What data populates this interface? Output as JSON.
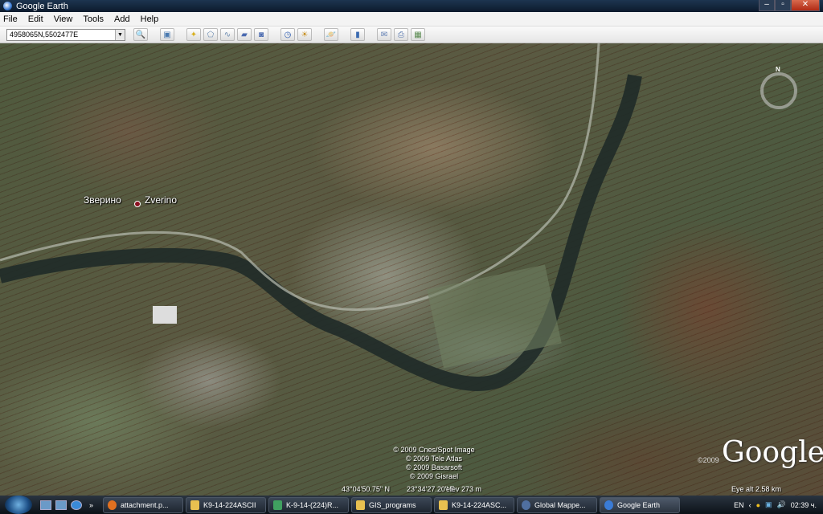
{
  "window": {
    "title": "Google Earth"
  },
  "menu": [
    "File",
    "Edit",
    "View",
    "Tools",
    "Add",
    "Help"
  ],
  "toolbar": {
    "search_value": "4958065N,5502477E"
  },
  "map": {
    "places": [
      {
        "label": "Зверино"
      },
      {
        "label": "Zverino"
      }
    ],
    "compass_label": "N",
    "copyright": [
      "© 2009 Cnes/Spot Image",
      "© 2009 Tele Atlas",
      "© 2009 Basarsoft",
      "© 2009 Gisrael"
    ],
    "logo": "Google",
    "logo_year": "©2009"
  },
  "status": {
    "lat": "43°04'50.75\" N",
    "lon": "23°34'27.20\" E",
    "elev": "elev  273 m",
    "eye_alt": "Eye alt    2.58 km"
  },
  "taskbar": {
    "tasks": [
      {
        "label": "attachment.p...",
        "color": "#e07020"
      },
      {
        "label": "K9-14-224ASCII",
        "color": "#e8c050"
      },
      {
        "label": "K-9-14-(224)R...",
        "color": "#40a060"
      },
      {
        "label": "GIS_programs",
        "color": "#e8c050"
      },
      {
        "label": "K9-14-224ASC...",
        "color": "#e8c050"
      },
      {
        "label": "Global Mappe...",
        "color": "#5070a0"
      },
      {
        "label": "Google Earth",
        "color": "#3a7bd5"
      }
    ],
    "lang": "EN",
    "clock": "02:39 ч."
  }
}
